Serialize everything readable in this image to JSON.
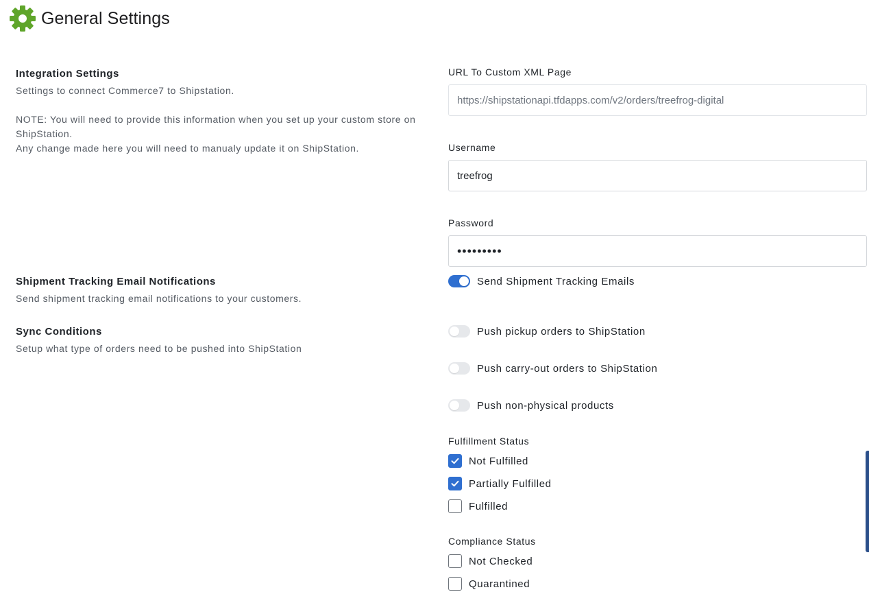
{
  "header": {
    "title": "General Settings",
    "icon": "gear-icon",
    "icon_color": "#5fa52a"
  },
  "integration": {
    "title": "Integration Settings",
    "description": "Settings to connect Commerce7 to Shipstation.",
    "note_line1": "NOTE: You will need to provide this information when you set up your custom store on ShipStation.",
    "note_line2": "Any change made here you will need to manualy update it on ShipStation.",
    "url_label": "URL To Custom XML Page",
    "url_value": "https://shipstationapi.tfdapps.com/v2/orders/treefrog-digital",
    "username_label": "Username",
    "username_value": "treefrog",
    "password_label": "Password",
    "password_value": "•••••••••"
  },
  "tracking": {
    "title": "Shipment Tracking Email Notifications",
    "description": "Send shipment tracking email notifications to your customers.",
    "toggle_label": "Send Shipment Tracking Emails",
    "toggle_on": true
  },
  "sync": {
    "title": "Sync Conditions",
    "description": "Setup what type of orders need to be pushed into ShipStation",
    "toggles": [
      {
        "label": "Push pickup orders to ShipStation",
        "on": false
      },
      {
        "label": "Push carry-out orders to ShipStation",
        "on": false
      },
      {
        "label": "Push non-physical products",
        "on": false
      }
    ],
    "fulfillment_title": "Fulfillment Status",
    "fulfillment": [
      {
        "label": "Not Fulfilled",
        "checked": true
      },
      {
        "label": "Partially Fulfilled",
        "checked": true
      },
      {
        "label": "Fulfilled",
        "checked": false
      }
    ],
    "compliance_title": "Compliance Status",
    "compliance": [
      {
        "label": "Not Checked",
        "checked": false
      },
      {
        "label": "Quarantined",
        "checked": false
      }
    ]
  },
  "colors": {
    "accent": "#2f6fd0",
    "toggle_off": "#e6e8eb",
    "muted_text": "#555b63"
  }
}
